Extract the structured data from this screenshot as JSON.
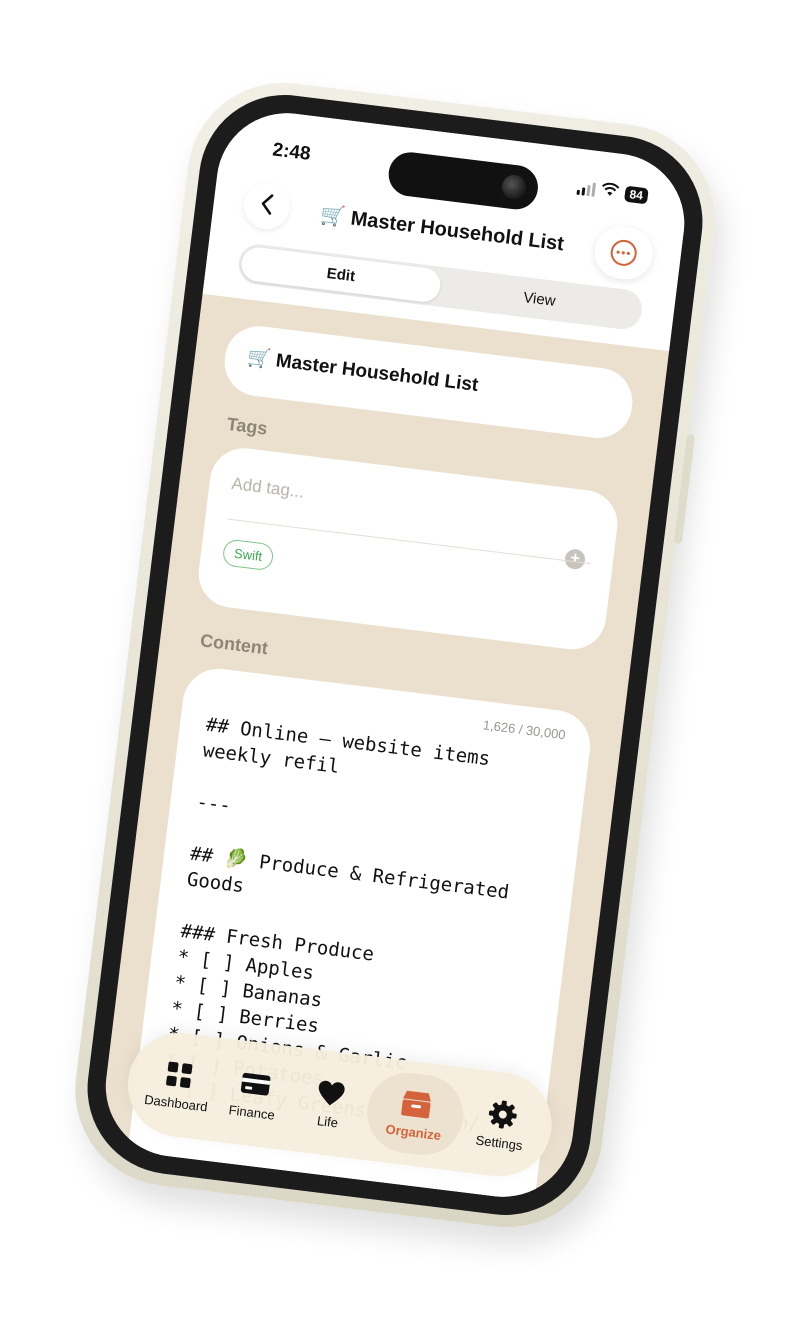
{
  "status_bar": {
    "time": "2:48",
    "battery": "84"
  },
  "header": {
    "title": "🛒 Master Household  List",
    "segments": [
      "Edit",
      "View"
    ],
    "active_segment": "Edit"
  },
  "note": {
    "title_value": "🛒 Master Household  List",
    "tags_label": "Tags",
    "tag_placeholder": "Add tag...",
    "tags": [
      "Swift"
    ],
    "content_label": "Content",
    "char_count": "1,626 / 30,000",
    "content": "## Online – website items weekly refil\n\n---\n\n## 🥬 Produce & Refrigerated Goods\n\n### Fresh Produce\n* [ ] Apples\n* [ ] Bananas\n* [ ] Berries\n* [ ] Onions & Garlic\n* [ ] Potatoes\n* [ ] Leafy Greens (Spinach/"
  },
  "tabbar": {
    "items": [
      {
        "label": "Dashboard",
        "icon": "grid-icon"
      },
      {
        "label": "Finance",
        "icon": "credit-card-icon"
      },
      {
        "label": "Life",
        "icon": "heart-icon"
      },
      {
        "label": "Organize",
        "icon": "archive-box-icon"
      },
      {
        "label": "Settings",
        "icon": "gear-icon"
      }
    ],
    "active": "Organize"
  },
  "colors": {
    "accent": "#d4623b",
    "background": "#ebe0cd",
    "tag_green": "#3da752"
  }
}
